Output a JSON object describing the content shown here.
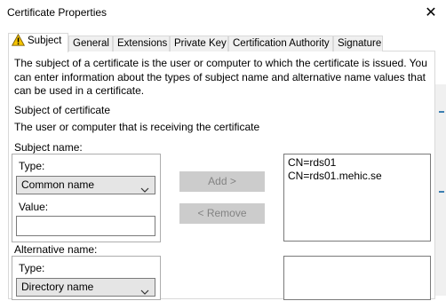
{
  "window": {
    "title": "Certificate Properties",
    "close_glyph": "✕"
  },
  "tabs": [
    {
      "label": "Subject",
      "icon": "warning-icon",
      "active": true
    },
    {
      "label": "General"
    },
    {
      "label": "Extensions"
    },
    {
      "label": "Private Key"
    },
    {
      "label": "Certification Authority"
    },
    {
      "label": "Signature"
    }
  ],
  "subject_tab": {
    "intro": "The subject of a certificate is the user or computer to which the certificate is issued. You can enter information about the types of subject name and alternative name values that can be used in a certificate.",
    "subject_heading": "Subject of certificate",
    "subject_desc": "The user or computer that is receiving the certificate",
    "subject_name": {
      "label": "Subject name:",
      "type_label": "Type:",
      "type_value": "Common name",
      "value_label": "Value:",
      "value_input": ""
    },
    "alternative_name": {
      "label": "Alternative name:",
      "type_label": "Type:",
      "type_value": "Directory name"
    },
    "buttons": {
      "add": "Add >",
      "remove": "< Remove"
    },
    "subject_list": [
      "CN=rds01",
      "CN=rds01.mehic.se"
    ],
    "alternative_list": []
  },
  "colors": {
    "warning_fill": "#f5c400",
    "disabled_button": "#cccccc",
    "disabled_text": "#838383"
  }
}
